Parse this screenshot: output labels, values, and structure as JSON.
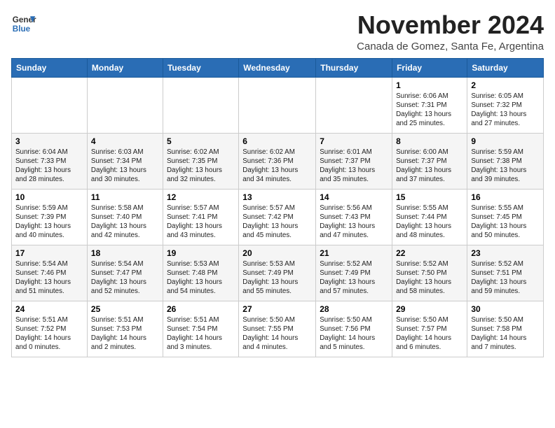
{
  "logo": {
    "line1": "General",
    "line2": "Blue"
  },
  "title": "November 2024",
  "location": "Canada de Gomez, Santa Fe, Argentina",
  "headers": [
    "Sunday",
    "Monday",
    "Tuesday",
    "Wednesday",
    "Thursday",
    "Friday",
    "Saturday"
  ],
  "weeks": [
    [
      {
        "day": "",
        "info": ""
      },
      {
        "day": "",
        "info": ""
      },
      {
        "day": "",
        "info": ""
      },
      {
        "day": "",
        "info": ""
      },
      {
        "day": "",
        "info": ""
      },
      {
        "day": "1",
        "info": "Sunrise: 6:06 AM\nSunset: 7:31 PM\nDaylight: 13 hours\nand 25 minutes."
      },
      {
        "day": "2",
        "info": "Sunrise: 6:05 AM\nSunset: 7:32 PM\nDaylight: 13 hours\nand 27 minutes."
      }
    ],
    [
      {
        "day": "3",
        "info": "Sunrise: 6:04 AM\nSunset: 7:33 PM\nDaylight: 13 hours\nand 28 minutes."
      },
      {
        "day": "4",
        "info": "Sunrise: 6:03 AM\nSunset: 7:34 PM\nDaylight: 13 hours\nand 30 minutes."
      },
      {
        "day": "5",
        "info": "Sunrise: 6:02 AM\nSunset: 7:35 PM\nDaylight: 13 hours\nand 32 minutes."
      },
      {
        "day": "6",
        "info": "Sunrise: 6:02 AM\nSunset: 7:36 PM\nDaylight: 13 hours\nand 34 minutes."
      },
      {
        "day": "7",
        "info": "Sunrise: 6:01 AM\nSunset: 7:37 PM\nDaylight: 13 hours\nand 35 minutes."
      },
      {
        "day": "8",
        "info": "Sunrise: 6:00 AM\nSunset: 7:37 PM\nDaylight: 13 hours\nand 37 minutes."
      },
      {
        "day": "9",
        "info": "Sunrise: 5:59 AM\nSunset: 7:38 PM\nDaylight: 13 hours\nand 39 minutes."
      }
    ],
    [
      {
        "day": "10",
        "info": "Sunrise: 5:59 AM\nSunset: 7:39 PM\nDaylight: 13 hours\nand 40 minutes."
      },
      {
        "day": "11",
        "info": "Sunrise: 5:58 AM\nSunset: 7:40 PM\nDaylight: 13 hours\nand 42 minutes."
      },
      {
        "day": "12",
        "info": "Sunrise: 5:57 AM\nSunset: 7:41 PM\nDaylight: 13 hours\nand 43 minutes."
      },
      {
        "day": "13",
        "info": "Sunrise: 5:57 AM\nSunset: 7:42 PM\nDaylight: 13 hours\nand 45 minutes."
      },
      {
        "day": "14",
        "info": "Sunrise: 5:56 AM\nSunset: 7:43 PM\nDaylight: 13 hours\nand 47 minutes."
      },
      {
        "day": "15",
        "info": "Sunrise: 5:55 AM\nSunset: 7:44 PM\nDaylight: 13 hours\nand 48 minutes."
      },
      {
        "day": "16",
        "info": "Sunrise: 5:55 AM\nSunset: 7:45 PM\nDaylight: 13 hours\nand 50 minutes."
      }
    ],
    [
      {
        "day": "17",
        "info": "Sunrise: 5:54 AM\nSunset: 7:46 PM\nDaylight: 13 hours\nand 51 minutes."
      },
      {
        "day": "18",
        "info": "Sunrise: 5:54 AM\nSunset: 7:47 PM\nDaylight: 13 hours\nand 52 minutes."
      },
      {
        "day": "19",
        "info": "Sunrise: 5:53 AM\nSunset: 7:48 PM\nDaylight: 13 hours\nand 54 minutes."
      },
      {
        "day": "20",
        "info": "Sunrise: 5:53 AM\nSunset: 7:49 PM\nDaylight: 13 hours\nand 55 minutes."
      },
      {
        "day": "21",
        "info": "Sunrise: 5:52 AM\nSunset: 7:49 PM\nDaylight: 13 hours\nand 57 minutes."
      },
      {
        "day": "22",
        "info": "Sunrise: 5:52 AM\nSunset: 7:50 PM\nDaylight: 13 hours\nand 58 minutes."
      },
      {
        "day": "23",
        "info": "Sunrise: 5:52 AM\nSunset: 7:51 PM\nDaylight: 13 hours\nand 59 minutes."
      }
    ],
    [
      {
        "day": "24",
        "info": "Sunrise: 5:51 AM\nSunset: 7:52 PM\nDaylight: 14 hours\nand 0 minutes."
      },
      {
        "day": "25",
        "info": "Sunrise: 5:51 AM\nSunset: 7:53 PM\nDaylight: 14 hours\nand 2 minutes."
      },
      {
        "day": "26",
        "info": "Sunrise: 5:51 AM\nSunset: 7:54 PM\nDaylight: 14 hours\nand 3 minutes."
      },
      {
        "day": "27",
        "info": "Sunrise: 5:50 AM\nSunset: 7:55 PM\nDaylight: 14 hours\nand 4 minutes."
      },
      {
        "day": "28",
        "info": "Sunrise: 5:50 AM\nSunset: 7:56 PM\nDaylight: 14 hours\nand 5 minutes."
      },
      {
        "day": "29",
        "info": "Sunrise: 5:50 AM\nSunset: 7:57 PM\nDaylight: 14 hours\nand 6 minutes."
      },
      {
        "day": "30",
        "info": "Sunrise: 5:50 AM\nSunset: 7:58 PM\nDaylight: 14 hours\nand 7 minutes."
      }
    ]
  ]
}
